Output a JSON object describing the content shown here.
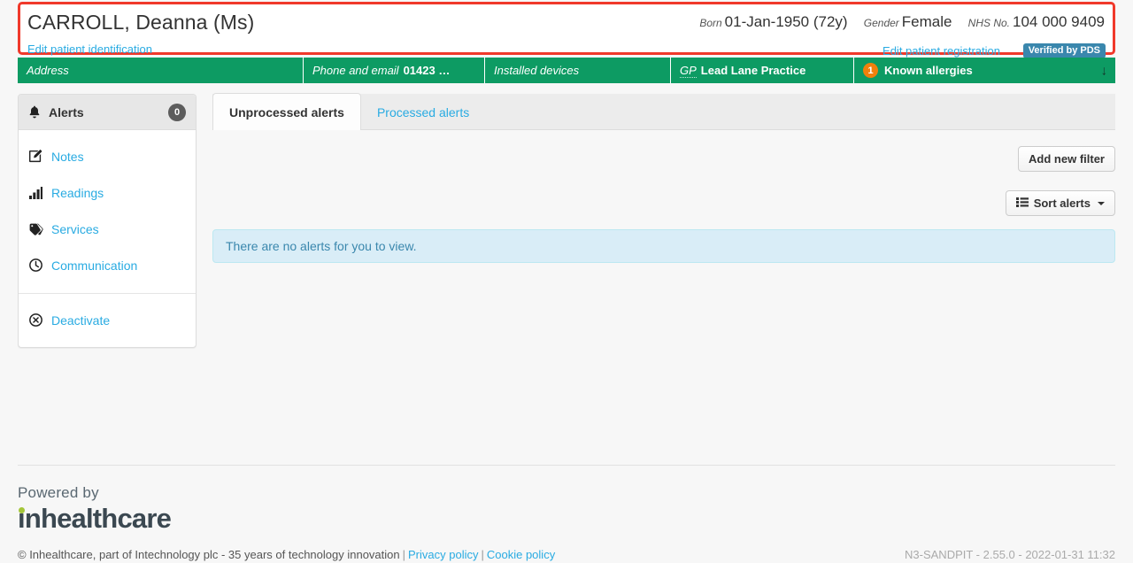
{
  "patient": {
    "name": "CARROLL, Deanna (Ms)",
    "edit_identification_link": "Edit patient identification",
    "edit_registration_link": "Edit patient registration",
    "verified_badge": "Verified by PDS",
    "born_label": "Born",
    "born_value": "01-Jan-1950 (72y)",
    "gender_label": "Gender",
    "gender_value": "Female",
    "nhs_label": "NHS No.",
    "nhs_value": "104 000 9409",
    "border_color": "#F0392B"
  },
  "summary_bar": {
    "background_color": "#0D9B63",
    "address_label": "Address",
    "phone_label": "Phone and email",
    "phone_value": "01423 …",
    "devices_label": "Installed devices",
    "gp_label": "GP",
    "gp_value": "Lead Lane Practice",
    "allergies_count": "1",
    "allergies_label": "Known allergies",
    "expand_icon": "↓",
    "allergy_badge_color": "#F0800C"
  },
  "sidebar": {
    "header": {
      "label": "Alerts",
      "count": "0",
      "icon": "bell-icon"
    },
    "items": [
      {
        "label": "Notes",
        "icon": "pencil-square-icon"
      },
      {
        "label": "Readings",
        "icon": "bar-chart-icon"
      },
      {
        "label": "Services",
        "icon": "tag-icon"
      },
      {
        "label": "Communication",
        "icon": "clock-icon"
      }
    ],
    "footer_items": [
      {
        "label": "Deactivate",
        "icon": "circle-x-icon"
      }
    ]
  },
  "tabs": [
    {
      "label": "Unprocessed alerts",
      "active": true
    },
    {
      "label": "Processed alerts",
      "active": false
    }
  ],
  "toolbar": {
    "add_filter_label": "Add new filter",
    "sort_label": "Sort alerts",
    "sort_icon": "list-icon",
    "caret_icon": "chevron-down-icon"
  },
  "content": {
    "empty_message": "There are no alerts for you to view."
  },
  "footer": {
    "powered_by": "Powered by",
    "brand": "inhealthcare",
    "copyright": "© Inhealthcare, part of Intechnology plc - 35 years of technology innovation",
    "privacy_link": "Privacy policy",
    "cookie_link": "Cookie policy",
    "separator": "|",
    "build_info": "N3-SANDPIT - 2.55.0 - 2022-01-31 11:32"
  }
}
